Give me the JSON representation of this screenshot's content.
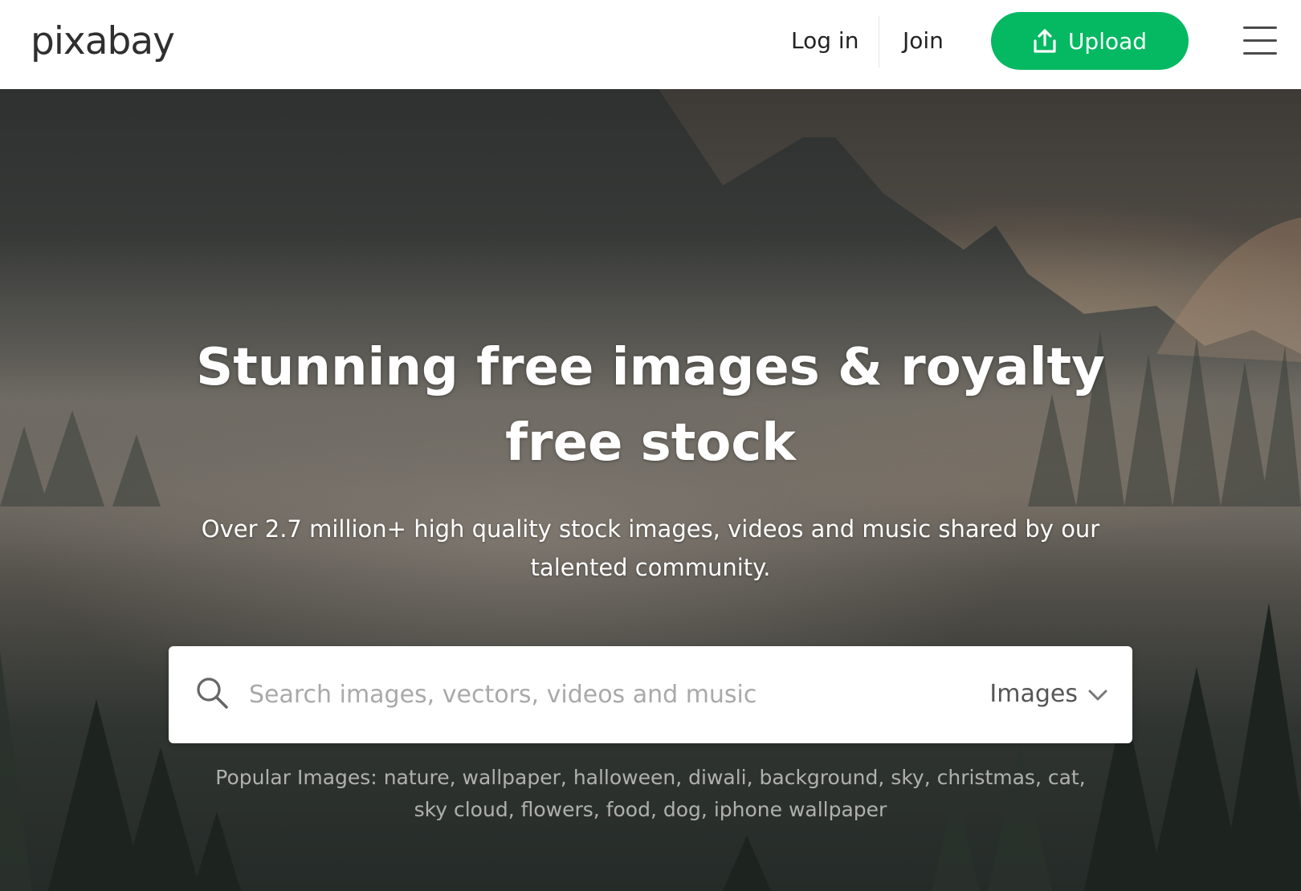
{
  "header": {
    "logo": "pixabay",
    "login_label": "Log in",
    "join_label": "Join",
    "upload_label": "Upload",
    "icons": {
      "upload": "upload-icon",
      "menu": "hamburger-menu-icon"
    },
    "accent_color": "#05b862"
  },
  "hero": {
    "title": "Stunning free images & royalty free stock",
    "subtitle": "Over 2.7 million+ high quality stock images, videos and music shared by our talented community."
  },
  "search": {
    "placeholder": "Search images, vectors, videos and music",
    "value": "",
    "type_selected": "Images",
    "icons": {
      "search": "search-icon",
      "dropdown": "chevron-down-icon"
    }
  },
  "popular": {
    "label": "Popular Images:",
    "tags": [
      "nature",
      "wallpaper",
      "halloween",
      "diwali",
      "background",
      "sky",
      "christmas",
      "cat",
      "sky cloud",
      "flowers",
      "food",
      "dog",
      "iphone wallpaper"
    ]
  }
}
